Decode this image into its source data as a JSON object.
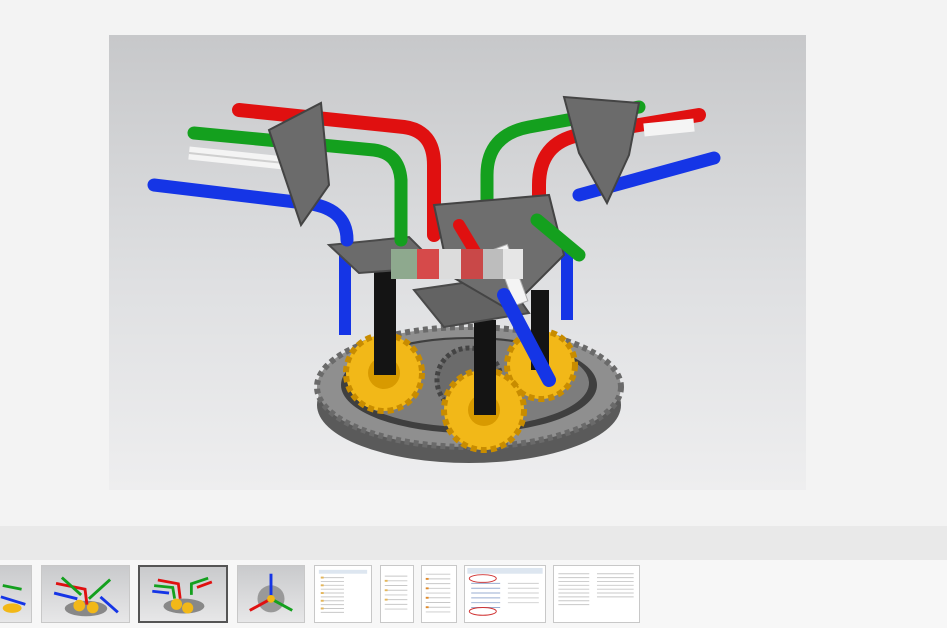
{
  "viewer": {
    "image_subject": "gear-assembly-render",
    "colors": {
      "rod_red": "#e01010",
      "rod_green": "#14a01e",
      "rod_blue": "#1535e6",
      "rod_white": "#f4f4f4",
      "gear_yellow": "#f2b818",
      "frame_gray": "#6b6b6b",
      "ring_gray": "#8a8a8a",
      "shaft_black": "#141414",
      "background_top": "#c7c8ca",
      "background_bottom": "#eeeeef"
    },
    "caption_text": ""
  },
  "thumbnails": [
    {
      "kind": "render",
      "label": "",
      "selected": false
    },
    {
      "kind": "render",
      "label": "",
      "selected": false
    },
    {
      "kind": "render",
      "label": "",
      "selected": true
    },
    {
      "kind": "render",
      "label": "",
      "selected": false
    },
    {
      "kind": "file-list",
      "label": "",
      "selected": false
    },
    {
      "kind": "file-list",
      "label": "",
      "selected": false
    },
    {
      "kind": "file-list",
      "label": "",
      "selected": false
    },
    {
      "kind": "file-list",
      "label": "",
      "selected": false
    },
    {
      "kind": "file-list",
      "label": "",
      "selected": false
    }
  ]
}
